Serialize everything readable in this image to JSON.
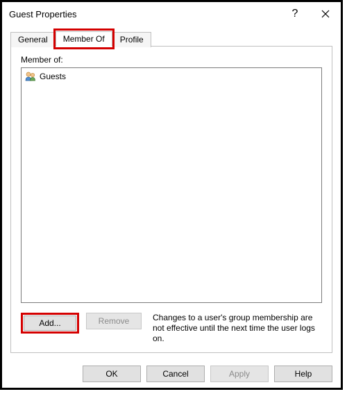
{
  "window": {
    "title": "Guest Properties"
  },
  "tabs": {
    "general": "General",
    "member_of": "Member Of",
    "profile": "Profile"
  },
  "content": {
    "member_of_label": "Member of:",
    "groups_list": [
      "Guests"
    ],
    "add_label": "Add...",
    "remove_label": "Remove",
    "hint": "Changes to a user's group membership are not effective until the next time the user logs on."
  },
  "buttons": {
    "ok": "OK",
    "cancel": "Cancel",
    "apply": "Apply",
    "help": "Help"
  }
}
